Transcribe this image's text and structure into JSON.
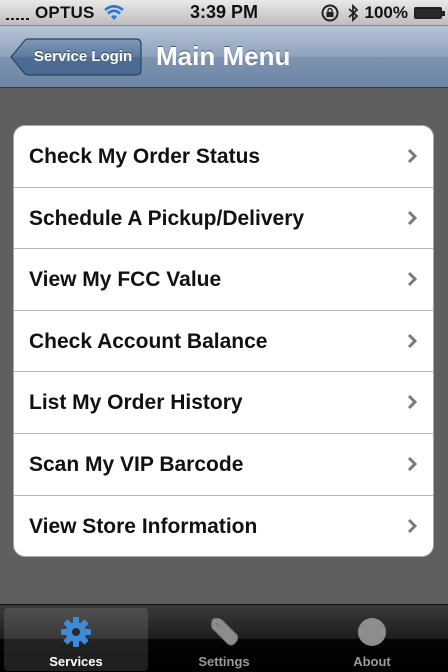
{
  "status_bar": {
    "carrier": "OPTUS",
    "time": "3:39 PM",
    "battery": "100%"
  },
  "nav": {
    "back_label": "Service Login",
    "title": "Main Menu"
  },
  "menu": {
    "items": [
      {
        "label": "Check My Order Status"
      },
      {
        "label": "Schedule A Pickup/Delivery"
      },
      {
        "label": "View My FCC Value"
      },
      {
        "label": "Check Account Balance"
      },
      {
        "label": "List My Order History"
      },
      {
        "label": "Scan My VIP Barcode"
      },
      {
        "label": "View Store Information"
      }
    ]
  },
  "tabs": [
    {
      "label": "Services",
      "icon": "gear-icon",
      "active": true
    },
    {
      "label": "Settings",
      "icon": "wrench-icon",
      "active": false
    },
    {
      "label": "About",
      "icon": "circle-icon",
      "active": false
    }
  ],
  "colors": {
    "nav_bar": "#7c93b1",
    "background": "#5f5f5f",
    "tab_bar": "#000000",
    "active_tab_icon": "#3e8ad6"
  }
}
